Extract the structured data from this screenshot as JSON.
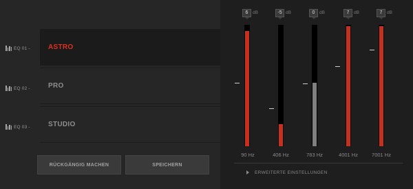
{
  "presets": [
    {
      "tag": "EQ 01 -",
      "name": "ASTRO",
      "active": true
    },
    {
      "tag": "EQ 02 -",
      "name": "PRO",
      "active": false
    },
    {
      "tag": "EQ 03 -",
      "name": "STUDIO",
      "active": false
    }
  ],
  "buttons": {
    "undo": "RÜCKGÄNGIG MACHEN",
    "save": "SPEICHERN"
  },
  "bands": [
    {
      "db": "6",
      "unit": "dB",
      "freq": "90 Hz",
      "level": 0.95,
      "color": "red"
    },
    {
      "db": "-5",
      "unit": "dB",
      "freq": "406 Hz",
      "level": 0.18,
      "color": "red"
    },
    {
      "db": "0",
      "unit": "dB",
      "freq": "783 Hz",
      "level": 0.52,
      "color": "gray"
    },
    {
      "db": "7",
      "unit": "dB",
      "freq": "4001 Hz",
      "level": 0.99,
      "color": "red"
    },
    {
      "db": "7",
      "unit": "dB",
      "freq": "7001 Hz",
      "level": 0.99,
      "color": "red"
    }
  ],
  "advanced": {
    "label": "ERWEITERTE EINSTELLUNGEN"
  },
  "colors": {
    "accent": "#e0301e",
    "bar_red": "#c8301e",
    "bar_gray": "#808080"
  }
}
